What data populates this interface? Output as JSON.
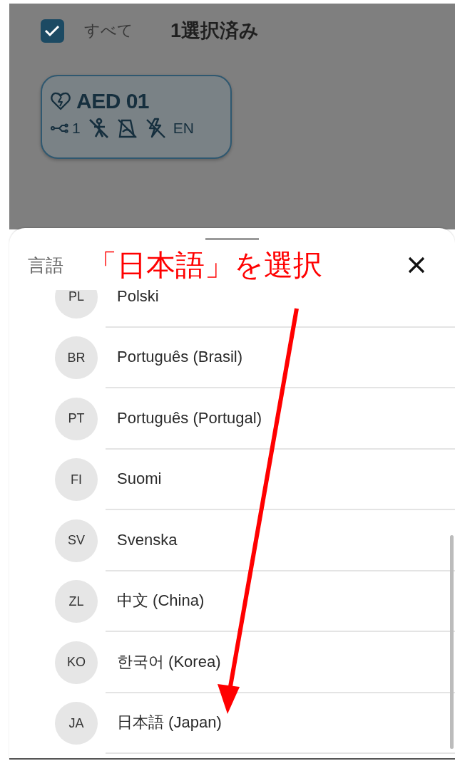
{
  "toolbar": {
    "select_all": {
      "label": "すべて",
      "checked": true
    },
    "selected_count": "1選択済み"
  },
  "devices": [
    {
      "name": "AED 01",
      "connections": "1",
      "language": "EN"
    }
  ],
  "sheet": {
    "title": "言語",
    "annotation": "「日本語」を選択",
    "languages": [
      {
        "code": "PL",
        "name": "Polski"
      },
      {
        "code": "BR",
        "name": "Português (Brasil)"
      },
      {
        "code": "PT",
        "name": "Português (Portugal)"
      },
      {
        "code": "FI",
        "name": "Suomi"
      },
      {
        "code": "SV",
        "name": "Svenska"
      },
      {
        "code": "ZL",
        "name": "中文 (China)"
      },
      {
        "code": "KO",
        "name": "한국어 (Korea)"
      },
      {
        "code": "JA",
        "name": "日本語 (Japan)"
      }
    ]
  }
}
